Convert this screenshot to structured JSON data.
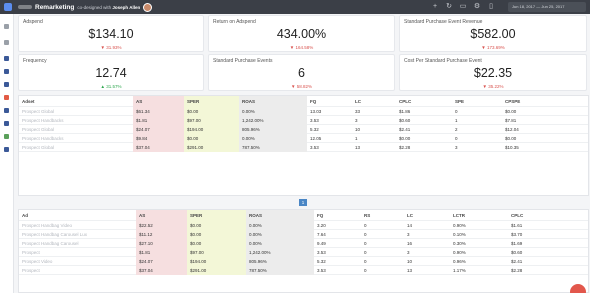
{
  "header": {
    "title": "Remarketing",
    "subtitle": "co-designed with",
    "author": "Joseph Allen",
    "date_range": "Jun 18, 2017 — Jun 25, 2017"
  },
  "colors": {
    "negative": "#d9534f",
    "positive": "#2fa84f",
    "as_highlight": "#f6dfe0",
    "spe_highlight": "#f3f7d7",
    "roas_highlight": "#ececec",
    "topbar": "#3b3f47"
  },
  "kpis": [
    {
      "label": "Adspend",
      "value": "$134.10",
      "change": "▼ 31.93%",
      "dir": "neg"
    },
    {
      "label": "Return on Adspend",
      "value": "434.00%",
      "change": "▼ 164.58%",
      "dir": "neg"
    },
    {
      "label": "Standard Purchase Event Revenue",
      "value": "$582.00",
      "change": "▼ 173.69%",
      "dir": "neg"
    },
    {
      "label": "Frequency",
      "value": "12.74",
      "change": "▲ 31.57%",
      "dir": "pos"
    },
    {
      "label": "Standard Purchase Events",
      "value": "6",
      "change": "▼ 58.82%",
      "dir": "neg"
    },
    {
      "label": "Cost Per Standard Purchase Event",
      "value": "$22.35",
      "change": "▼ 35.22%",
      "dir": "neg"
    }
  ],
  "adset_table": {
    "headers": [
      "Adset",
      "AS",
      "SPER",
      "ROAS",
      "FQ",
      "LC",
      "CPLC",
      "SPE",
      "CPSPE"
    ],
    "rows": [
      [
        "Prospect Global",
        "$61.34",
        "$0.00",
        "0.00%",
        "13.03",
        "33",
        "$1.86",
        "0",
        "$0.00"
      ],
      [
        "Prospect Handbacks",
        "$1.81",
        "$97.00",
        "1,242.00%",
        "3.53",
        "3",
        "$0.60",
        "1",
        "$7.81"
      ],
      [
        "Prospect Global",
        "$24.07",
        "$194.00",
        "805.96%",
        "5.32",
        "10",
        "$2.41",
        "2",
        "$12.04"
      ],
      [
        "Prospect Handbacks",
        "$9.84",
        "$0.00",
        "0.00%",
        "12.05",
        "1",
        "$0.00",
        "0",
        "$0.00"
      ],
      [
        "Prospect Global",
        "$37.04",
        "$291.00",
        "787.50%",
        "3.53",
        "13",
        "$2.28",
        "3",
        "$10.35"
      ]
    ]
  },
  "pager": {
    "page": "1"
  },
  "ad_table": {
    "headers": [
      "Ad",
      "AS",
      "SPER",
      "ROAS",
      "FQ",
      "RS",
      "LC",
      "LCTR",
      "CPLC"
    ],
    "rows": [
      [
        "Prospect Handbag Video",
        "$22.52",
        "$0.00",
        "0.00%",
        "3.20",
        "0",
        "14",
        "0.90%",
        "$1.61"
      ],
      [
        "Prospect Handbag Carousel Lux",
        "$11.12",
        "$0.00",
        "0.00%",
        "7.64",
        "0",
        "3",
        "0.10%",
        "$3.70"
      ],
      [
        "Prospect Handbag Carousel",
        "$27.10",
        "$0.00",
        "0.00%",
        "9.49",
        "0",
        "16",
        "0.30%",
        "$1.69"
      ],
      [
        "Prospect",
        "$1.81",
        "$97.00",
        "1,242.00%",
        "3.53",
        "0",
        "3",
        "0.90%",
        "$0.60"
      ],
      [
        "Prospect Video",
        "$24.07",
        "$194.00",
        "805.96%",
        "5.32",
        "0",
        "10",
        "0.96%",
        "$2.41"
      ],
      [
        "Prospect",
        "$37.04",
        "$291.00",
        "787.50%",
        "3.53",
        "0",
        "13",
        "1.17%",
        "$2.28"
      ]
    ]
  }
}
